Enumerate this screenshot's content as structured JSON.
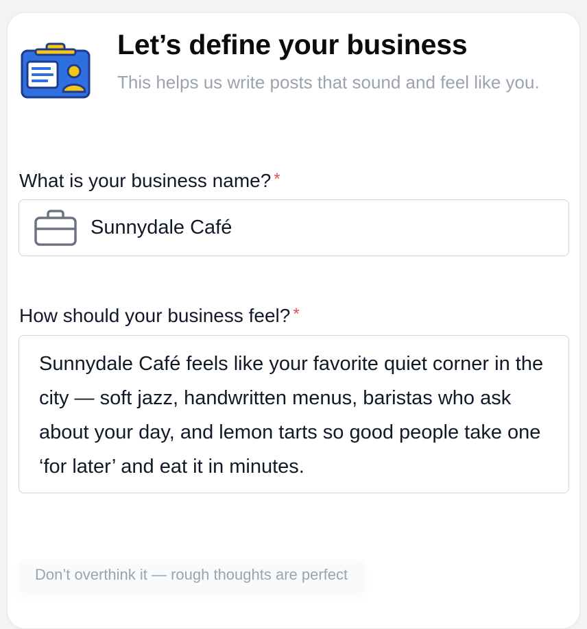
{
  "header": {
    "icon": "id-badge-icon",
    "title": "Let’s define your business",
    "subtitle": "This helps us write posts that sound and feel like you."
  },
  "business_name": {
    "label": "What is your business name?",
    "required_marker": "*",
    "icon": "briefcase-icon",
    "value": "Sunnydale Café"
  },
  "business_feel": {
    "label": "How should your business feel?",
    "required_marker": "*",
    "value": "Sunnydale Café feels like your favorite quiet corner in the city — soft jazz, handwritten menus, baristas who ask about your day, and lemon tarts so good people take one ‘for later’ and eat it in minutes."
  },
  "hint": "Don’t overthink it — rough thoughts are perfect",
  "colors": {
    "required": "#e05252",
    "badge_blue": "#2f6fe0",
    "badge_yellow": "#f5c518",
    "border": "#d1d5db"
  }
}
